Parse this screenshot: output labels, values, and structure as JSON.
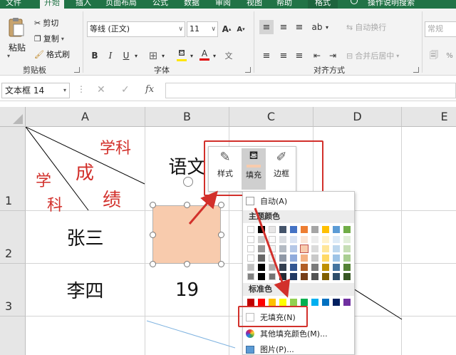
{
  "ribbon_tabs": [
    "文件",
    "开始",
    "插入",
    "页面布局",
    "公式",
    "数据",
    "审阅",
    "视图",
    "帮助",
    "格式"
  ],
  "tell_me": "操作说明搜索",
  "clipboard": {
    "paste": "粘贴",
    "cut": "剪切",
    "copy": "复制",
    "format_painter": "格式刷",
    "label": "剪贴板"
  },
  "font": {
    "name": "等线 (正文)",
    "size": "11",
    "increase": "A",
    "decrease": "A",
    "bold": "B",
    "italic": "I",
    "underline": "U",
    "font_color_letter": "A",
    "label": "字体"
  },
  "alignment": {
    "wrap": "自动换行",
    "merge": "合并后居中",
    "label": "对齐方式"
  },
  "number": {
    "format": "常规"
  },
  "name_box": "文本框 14",
  "fx": "fx",
  "columns": [
    "A",
    "B",
    "C",
    "D",
    "E"
  ],
  "rows": [
    "1",
    "2",
    "3"
  ],
  "cells": {
    "a1": {
      "xueke": "学科",
      "cheng": "成",
      "ji": "绩",
      "xue": "学",
      "ke": "科"
    },
    "b1": "语文",
    "a2": "张三",
    "a3": "李四",
    "b3": "19"
  },
  "mini_toolbar": {
    "style": "样式",
    "fill": "填充",
    "border": "边框"
  },
  "fill_menu": {
    "auto": "自动(A)",
    "theme_colors": "主题颜色",
    "standard_colors": "标准色",
    "no_fill": "无填充(N)",
    "more_colors": "其他填充颜色(M)...",
    "picture": "图片(P)...",
    "theme_top": [
      "#ffffff",
      "#000000",
      "#e7e6e6",
      "#44546a",
      "#4472c4",
      "#ed7d31",
      "#a5a5a5",
      "#ffc000",
      "#5b9bd5",
      "#70ad47"
    ],
    "standard": [
      "#c00000",
      "#ff0000",
      "#ffc000",
      "#ffff00",
      "#92d050",
      "#00b050",
      "#00b0f0",
      "#0070c0",
      "#002060",
      "#7030a0"
    ]
  },
  "colors": {
    "accent": "#217346",
    "annotation": "#d2302b",
    "shape_fill": "#f8cbad"
  }
}
